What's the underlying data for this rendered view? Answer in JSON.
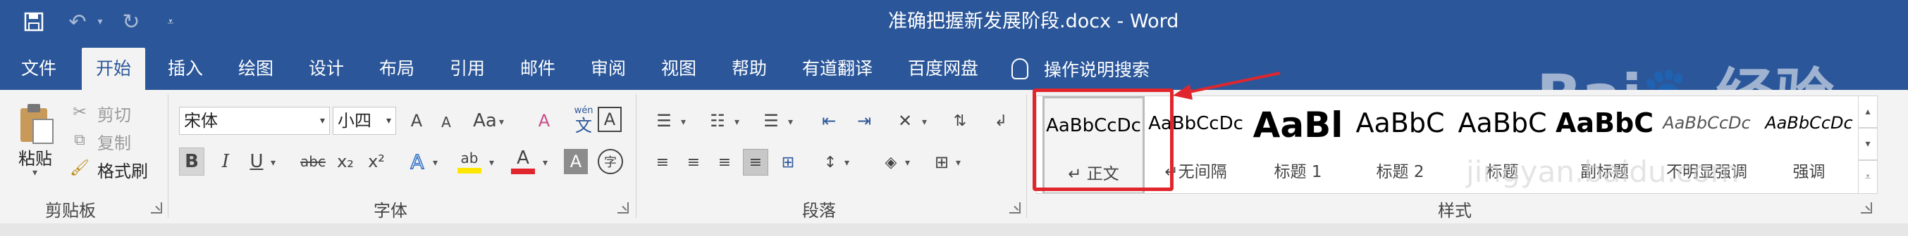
{
  "app": {
    "title": "准确把握新发展阶段.docx  -  Word"
  },
  "quick_access": {
    "save_icon": "save-icon",
    "undo_icon": "undo-icon",
    "redo_icon": "redo-icon",
    "customize_icon": "customize-qat-icon"
  },
  "tabs": [
    "文件",
    "开始",
    "插入",
    "绘图",
    "设计",
    "布局",
    "引用",
    "邮件",
    "审阅",
    "视图",
    "帮助",
    "有道翻译",
    "百度网盘"
  ],
  "active_tab": "开始",
  "tell_me": "操作说明搜索",
  "clipboard": {
    "paste": "粘贴",
    "cut": "剪切",
    "copy": "复制",
    "format_painter": "格式刷",
    "label": "剪贴板"
  },
  "font": {
    "name": "宋体",
    "size": "小四",
    "label": "字体",
    "grow": "A",
    "shrink": "A",
    "change_case": "Aa",
    "phonetic_top": "wén",
    "phonetic_bottom": "文",
    "char_border": "A",
    "bold": "B",
    "italic": "I",
    "underline": "U",
    "strike": "abc",
    "subscript": "x₂",
    "superscript": "x²",
    "text_effects": "A",
    "highlight": "ab",
    "font_color": "A",
    "char_shading": "A",
    "enclose": "字"
  },
  "paragraph": {
    "label": "段落"
  },
  "styles": {
    "label": "样式",
    "items": [
      {
        "preview": "AaBbCcDc",
        "name": "正文",
        "mark": "↵"
      },
      {
        "preview": "AaBbCcDc",
        "name": "无间隔",
        "mark": "↵"
      },
      {
        "preview": "AaBl",
        "name": "标题 1"
      },
      {
        "preview": "AaBbC",
        "name": "标题 2"
      },
      {
        "preview": "AaBbC",
        "name": "标题"
      },
      {
        "preview": "AaBbC",
        "name": "副标题"
      },
      {
        "preview": "AaBbCcDc",
        "name": "不明显强调"
      },
      {
        "preview": "AaBbCcDc",
        "name": "强调"
      }
    ]
  },
  "watermark": {
    "logo": "Bai",
    "logo_suffix": "经验",
    "url": "jingyan.baidu.com"
  },
  "colors": {
    "word_blue": "#2b579a",
    "highlight_red": "#e0262c",
    "font_red": "#e0262c",
    "highlight_yellow": "#ffe600"
  }
}
